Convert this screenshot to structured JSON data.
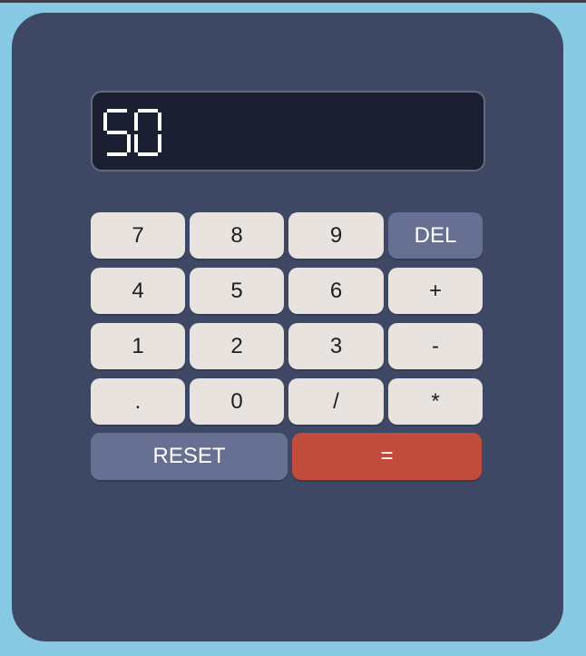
{
  "display": {
    "value": "50"
  },
  "keypad": {
    "row1": [
      "7",
      "8",
      "9",
      "DEL"
    ],
    "row2": [
      "4",
      "5",
      "6",
      "+"
    ],
    "row3": [
      "1",
      "2",
      "3",
      "-"
    ],
    "row4": [
      ".",
      "0",
      "/",
      "*"
    ],
    "reset_label": "RESET",
    "equals_label": "="
  },
  "colors": {
    "page_background": "#87c8e3",
    "calculator_body": "#3e4865",
    "display_background": "#1b1f32",
    "key": "#e8e3df",
    "key_secondary": "#676f93",
    "key_equals": "#c24c3c"
  }
}
